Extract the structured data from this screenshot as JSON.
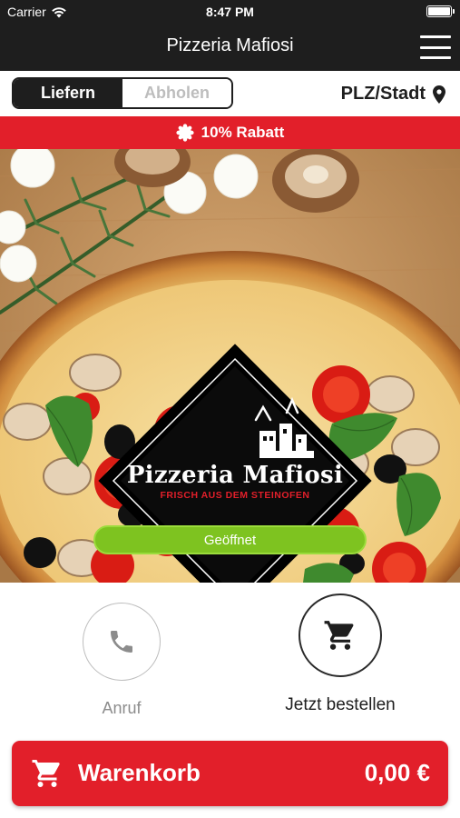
{
  "status_bar": {
    "carrier": "Carrier",
    "time": "8:47 PM"
  },
  "header": {
    "title": "Pizzeria Mafiosi"
  },
  "mode": {
    "delivery_label": "Liefern",
    "pickup_label": "Abholen",
    "selected": "Liefern",
    "location_label": "PLZ/Stadt"
  },
  "promo": {
    "text": "10% Rabatt"
  },
  "hero": {
    "logo_title": "Pizzeria Mafiosi",
    "logo_tagline": "FRISCH AUS DEM STEINOFEN",
    "open_status": "Geöffnet"
  },
  "actions": {
    "call_label": "Anruf",
    "order_label": "Jetzt bestellen"
  },
  "cart": {
    "label": "Warenkorb",
    "total": "0,00 €"
  },
  "colors": {
    "accent_red": "#e21f2a",
    "dark": "#1e1e1e",
    "open_green": "#7ec320"
  },
  "icons": [
    "wifi-icon",
    "battery-icon",
    "hamburger-menu-icon",
    "location-pin-icon",
    "badge-icon",
    "phone-icon",
    "cart-icon"
  ]
}
